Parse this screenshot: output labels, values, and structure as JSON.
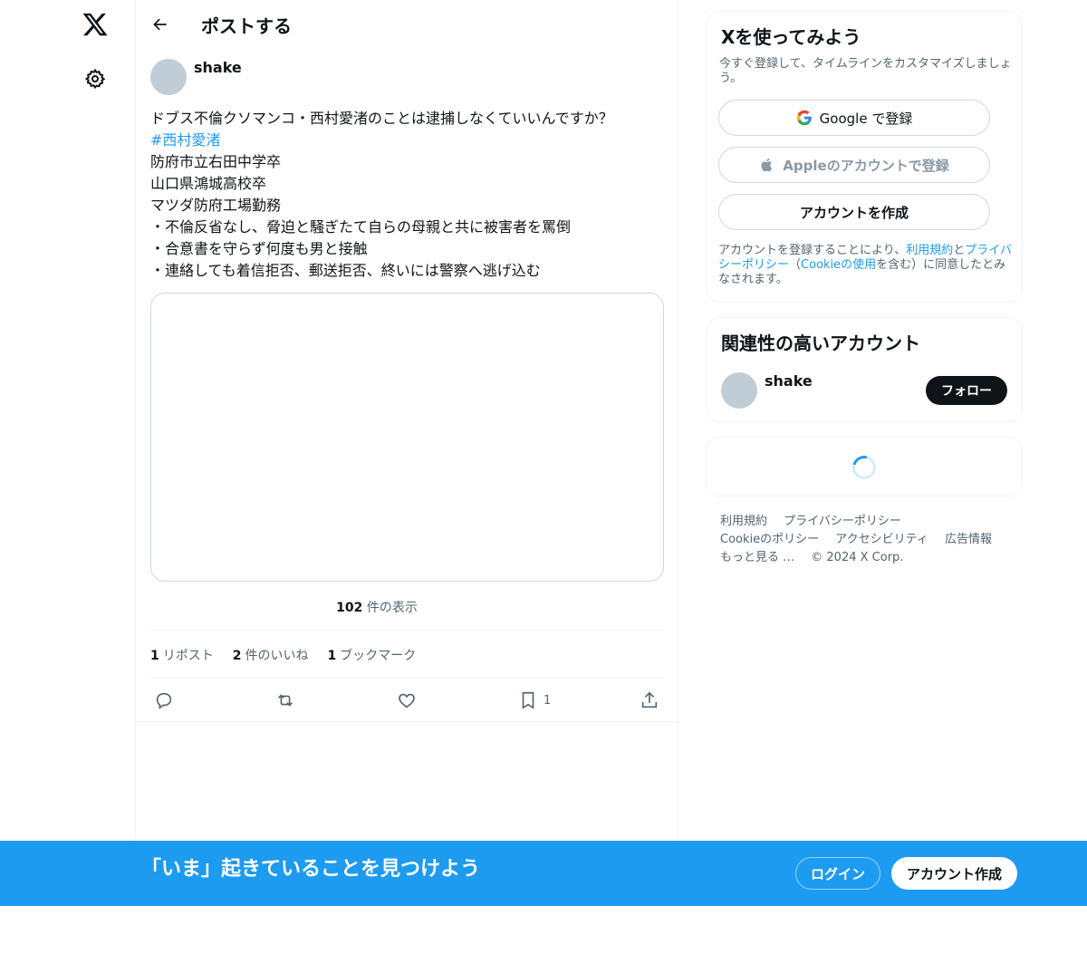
{
  "header": {
    "title": "ポストする"
  },
  "post": {
    "author": "shake",
    "lines": [
      "ドブス不倫クソマンコ・西村愛渚のことは逮捕しなくていいんですか？",
      "#西村愛渚",
      "防府市立右田中学卒",
      "山口県鴻城高校卒",
      "マツダ防府工場勤務",
      "・不倫反省なし、脅迫と騒ぎたて自らの母親と共に被害者を罵倒",
      "・合意書を守らず何度も男と接触",
      "・連絡しても着信拒否、郵送拒否、終いには警察へ逃げ込む"
    ],
    "views_count": "102",
    "views_label": "件の表示",
    "stats": [
      {
        "count": "1",
        "label": "リポスト"
      },
      {
        "count": "2",
        "label": "件のいいね"
      },
      {
        "count": "1",
        "label": "ブックマーク"
      }
    ],
    "bookmark_count": "1"
  },
  "sidebar": {
    "signup": {
      "title": "Xを使ってみよう",
      "subtitle": "今すぐ登録して、タイムラインをカスタマイズしましょう。",
      "google_label": "Google で登録",
      "apple_label": "Appleのアカウントで登録",
      "create_label": "アカウントを作成",
      "terms_prefix": "アカウントを登録することにより、",
      "terms_link": "利用規約",
      "terms_and": "と",
      "privacy_link": "プライバシーポリシー",
      "terms_paren_open": "（",
      "cookie_link": "Cookieの使用",
      "terms_suffix": "を含む）に同意したとみなされます。"
    },
    "relevant": {
      "title": "関連性の高いアカウント",
      "name": "shake",
      "follow_label": "フォロー"
    }
  },
  "footer": {
    "links": [
      "利用規約",
      "プライバシーポリシー",
      "Cookieのポリシー",
      "アクセシビリティ",
      "広告情報",
      "もっと見る …"
    ],
    "copyright": "© 2024 X Corp."
  },
  "bottom_bar": {
    "title": "「いま」起きていることを見つけよう",
    "login_label": "ログイン",
    "create_label": "アカウント作成"
  },
  "colors": {
    "accent": "#1d9bf0",
    "text": "#0f1419",
    "muted": "#536471",
    "border": "#eff3f4"
  }
}
